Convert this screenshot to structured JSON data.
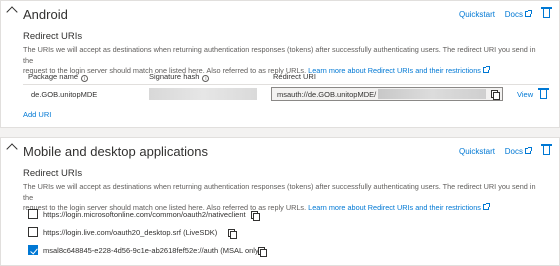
{
  "android": {
    "title": "Android",
    "quickstart": "Quickstart",
    "docs": "Docs",
    "redirect_title": "Redirect URIs",
    "desc_line1": "The URIs we will accept as destinations when returning authentication responses (tokens) after successfully authenticating users. The redirect URI you send in the",
    "desc_line2": "request to the login server should match one listed here. Also referred to as reply URLs.",
    "desc_link": "Learn more about Redirect URIs and their restrictions",
    "columns": [
      "Package name",
      "Signature hash",
      "Redirect URI"
    ],
    "row": {
      "package": "de.GOB.unitopMDE",
      "redirect_prefix": "msauth://de.GOB.unitopMDE/",
      "view": "View"
    },
    "add_uri": "Add URI"
  },
  "mobile": {
    "title": "Mobile and desktop applications",
    "quickstart": "Quickstart",
    "docs": "Docs",
    "redirect_title": "Redirect URIs",
    "desc_line1": "The URIs we will accept as destinations when returning authentication responses (tokens) after successfully authenticating users. The redirect URI you send in the",
    "desc_line2": "request to the login server should match one listed here. Also referred to as reply URLs.",
    "desc_link": "Learn more about Redirect URIs and their restrictions",
    "uris": [
      {
        "label": "https://login.microsoftonline.com/common/oauth2/nativeclient",
        "checked": false
      },
      {
        "label": "https://login.live.com/oauth20_desktop.srf (LiveSDK)",
        "checked": false
      },
      {
        "label": "msal8c648845-e228-4d56-9c1e-ab2618fef52e://auth (MSAL only)",
        "checked": true
      }
    ]
  },
  "colors": {
    "accent": "#0078d4",
    "border": "#e1dfdd",
    "background": "#f3f2f1"
  }
}
